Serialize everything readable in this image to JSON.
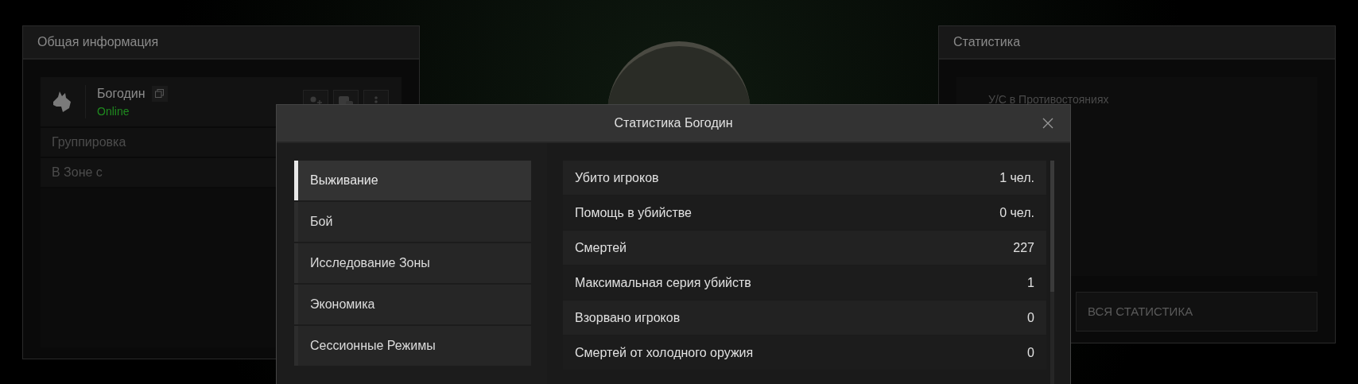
{
  "general_panel": {
    "title": "Общая информация",
    "profile": {
      "name": "Богодин",
      "status": "Online"
    },
    "rows": [
      {
        "label": "Группировка"
      },
      {
        "label": "В Зоне с"
      }
    ]
  },
  "stats_panel": {
    "title": "Статистика",
    "chart_label": "У/С в Противостояниях",
    "button": "ВСЯ СТАТИСТИКА"
  },
  "modal": {
    "title": "Статистика Богодин",
    "tabs": [
      {
        "label": "Выживание",
        "selected": true
      },
      {
        "label": "Бой",
        "selected": false
      },
      {
        "label": "Исследование Зоны",
        "selected": false
      },
      {
        "label": "Экономика",
        "selected": false
      },
      {
        "label": "Сессионные Режимы",
        "selected": false
      }
    ],
    "rows": [
      {
        "label": "Убито игроков",
        "value": "1 чел."
      },
      {
        "label": "Помощь в убийстве",
        "value": "0 чел."
      },
      {
        "label": "Смертей",
        "value": "227"
      },
      {
        "label": "Максимальная серия убийств",
        "value": "1"
      },
      {
        "label": "Взорвано игроков",
        "value": "0"
      },
      {
        "label": "Смертей от холодного оружия",
        "value": "0"
      }
    ]
  }
}
